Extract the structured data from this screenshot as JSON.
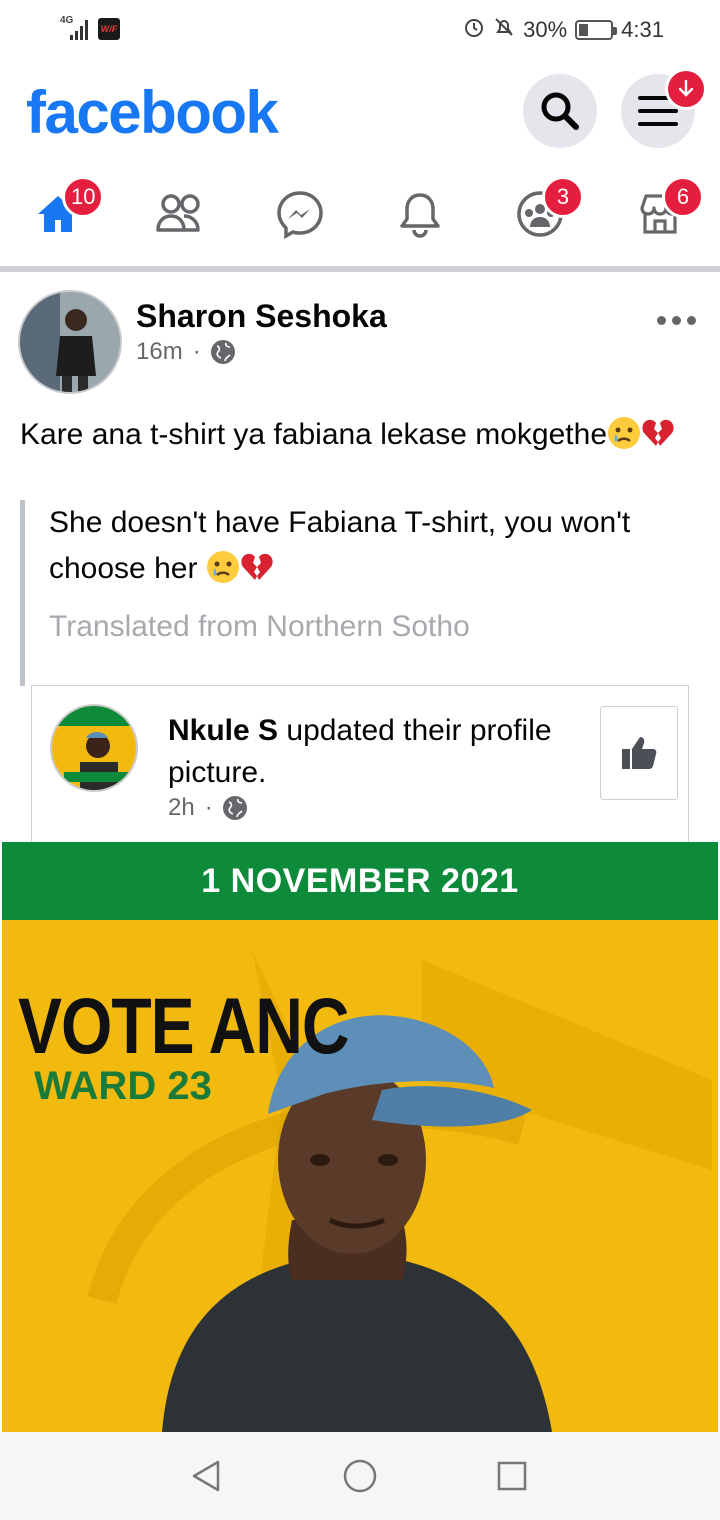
{
  "status_bar": {
    "network": "4G",
    "battery_percent": "30%",
    "battery_level": 0.3,
    "time": "4:31",
    "icons": [
      "signal-icon",
      "app-notification-icon",
      "alarm-icon",
      "mute-icon",
      "battery-icon"
    ]
  },
  "header": {
    "logo": "facebook",
    "menu_badge_icon": "download-arrow-icon"
  },
  "nav": {
    "items": [
      {
        "name": "home",
        "badge": "10",
        "active": true
      },
      {
        "name": "friends",
        "badge": ""
      },
      {
        "name": "messenger",
        "badge": ""
      },
      {
        "name": "notifications",
        "badge": ""
      },
      {
        "name": "groups",
        "badge": "3"
      },
      {
        "name": "marketplace",
        "badge": "6"
      }
    ],
    "accent": "#1877f2",
    "badge_color": "#e41e3f"
  },
  "post": {
    "author": "Sharon Seshoka",
    "time": "16m",
    "privacy_icon": "globe-icon",
    "text": "Kare ana t-shirt ya fabiana lekase mokgethe",
    "translation": "She doesn't have Fabiana T-shirt, you won't choose her",
    "translation_note": "Translated from Northern Sotho",
    "emojis": [
      "crying-face-emoji",
      "broken-heart-emoji"
    ]
  },
  "shared": {
    "author": "Nkule S",
    "action": " updated their profile picture.",
    "time": "2h",
    "like_icon": "thumbs-up-icon"
  },
  "poster": {
    "date": "1 NOVEMBER 2021",
    "headline": "VOTE ANC",
    "ward": "WARD 23",
    "colors": {
      "green": "#0d8a3a",
      "yellow": "#f2b90f"
    }
  },
  "system_nav": [
    "back-icon",
    "home-circle-icon",
    "recents-icon"
  ]
}
